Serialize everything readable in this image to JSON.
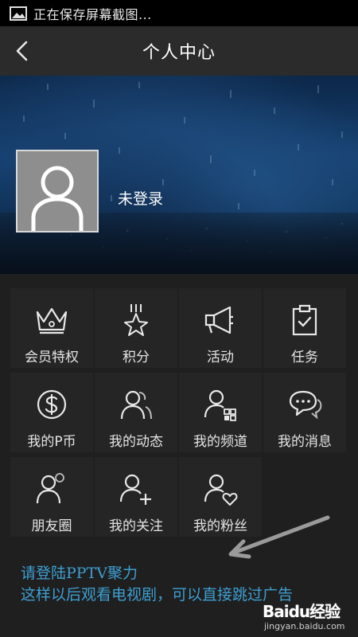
{
  "status_bar": {
    "text": "正在保存屏幕截图..."
  },
  "header": {
    "title": "个人中心"
  },
  "profile": {
    "login_status": "未登录"
  },
  "menu": [
    {
      "label": "会员特权",
      "icon": "crown-icon"
    },
    {
      "label": "积分",
      "icon": "star-medal-icon"
    },
    {
      "label": "活动",
      "icon": "megaphone-icon"
    },
    {
      "label": "任务",
      "icon": "clipboard-check-icon"
    },
    {
      "label": "我的P币",
      "icon": "dollar-coin-icon"
    },
    {
      "label": "我的动态",
      "icon": "users-icon"
    },
    {
      "label": "我的频道",
      "icon": "user-grid-icon"
    },
    {
      "label": "我的消息",
      "icon": "chat-bubbles-icon"
    },
    {
      "label": "朋友圈",
      "icon": "user-circle-icon"
    },
    {
      "label": "我的关注",
      "icon": "user-plus-icon"
    },
    {
      "label": "我的粉丝",
      "icon": "user-heart-icon"
    }
  ],
  "annotation": {
    "line1": "请登陆PPTV聚力",
    "line2": "这样以后观看电视剧，可以直接跳过广告"
  },
  "watermark": {
    "brand": "Baidu经验",
    "url": "jingyan.baidu.com"
  },
  "colors": {
    "annotation": "#3d9fd2",
    "background": "#1f1f1f",
    "cell": "#252525"
  }
}
